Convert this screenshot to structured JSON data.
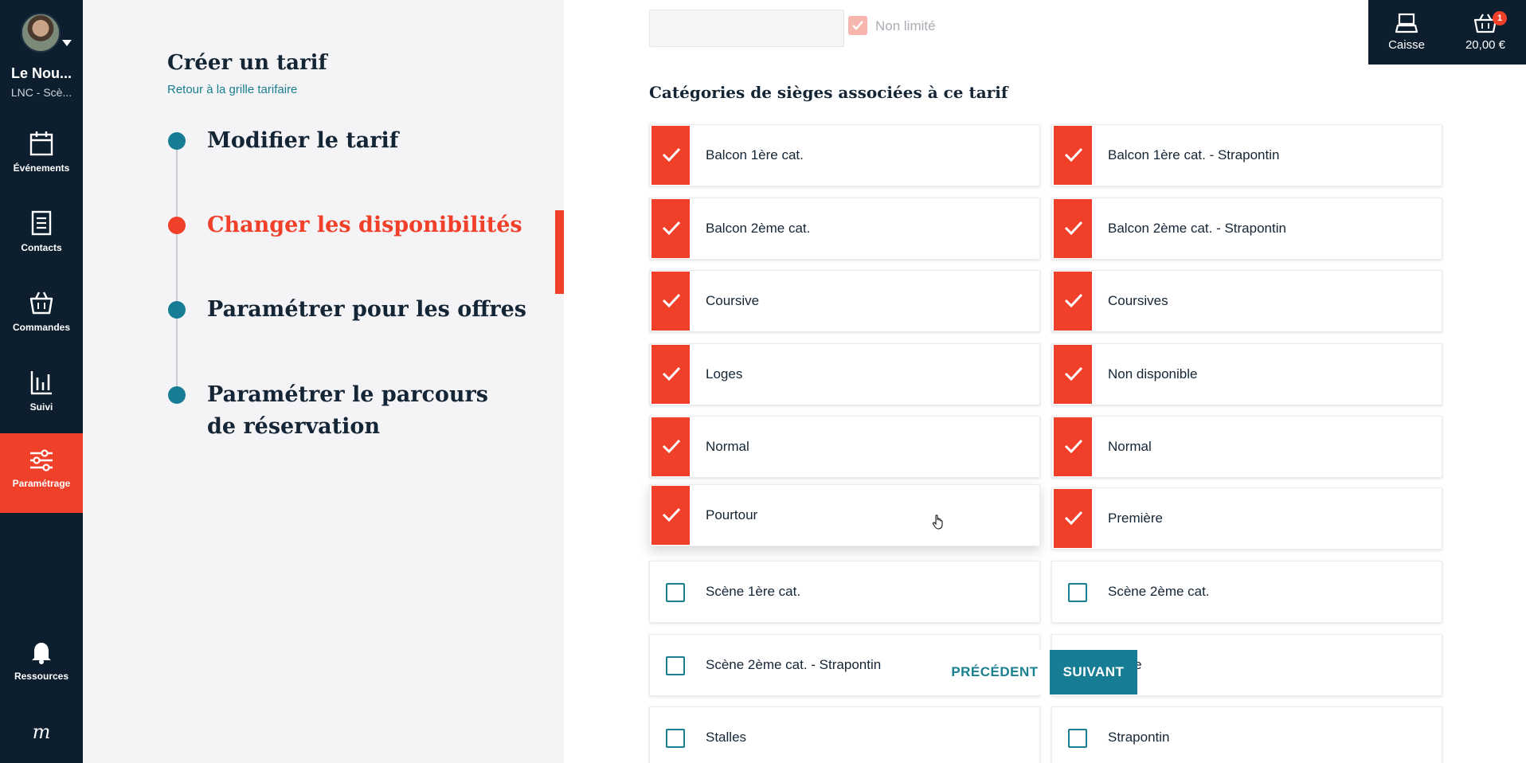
{
  "sidebar": {
    "org_name": "Le Nou...",
    "org_sub": "LNC - Scè...",
    "items": [
      {
        "label": "Événements",
        "icon": "calendar-icon"
      },
      {
        "label": "Contacts",
        "icon": "document-icon"
      },
      {
        "label": "Commandes",
        "icon": "basket-icon"
      },
      {
        "label": "Suivi",
        "icon": "bar-chart-icon"
      },
      {
        "label": "Paramétrage",
        "icon": "sliders-icon"
      },
      {
        "label": "Ressources",
        "icon": "bell-icon"
      }
    ],
    "logo": "m"
  },
  "left_panel": {
    "title": "Créer un tarif",
    "back_link": "Retour à la grille tarifaire",
    "steps": [
      {
        "label": "Modifier le tarif"
      },
      {
        "label": "Changer les disponibilités"
      },
      {
        "label": "Paramétrer pour les offres"
      },
      {
        "label": "Paramétrer le parcours de réservation"
      }
    ]
  },
  "content": {
    "non_limite_label": "Non limité",
    "section_title": "Catégories de sièges associées à ce tarif",
    "categories": [
      {
        "label": "Balcon 1ère cat.",
        "checked": true
      },
      {
        "label": "Balcon 1ère cat. - Strapontin",
        "checked": true
      },
      {
        "label": "Balcon 2ème cat.",
        "checked": true
      },
      {
        "label": "Balcon 2ème cat. - Strapontin",
        "checked": true
      },
      {
        "label": "Coursive",
        "checked": true
      },
      {
        "label": "Coursives",
        "checked": true
      },
      {
        "label": "Loges",
        "checked": true
      },
      {
        "label": "Non disponible",
        "checked": true
      },
      {
        "label": "Normal",
        "checked": true
      },
      {
        "label": "Normal",
        "checked": true
      },
      {
        "label": "Pourtour",
        "checked": true
      },
      {
        "label": "Première",
        "checked": true
      },
      {
        "label": "Scène 1ère cat.",
        "checked": false
      },
      {
        "label": "Scène 2ème cat.",
        "checked": false
      },
      {
        "label": "Scène 2ème cat. - Strapontin",
        "checked": false
      },
      {
        "label": "...nde",
        "checked": false
      },
      {
        "label": "Stalles",
        "checked": false
      },
      {
        "label": "Strapontin",
        "checked": false
      }
    ]
  },
  "topbar": {
    "caisse_label": "Caisse",
    "cart_total": "20,00 €",
    "cart_count": "1"
  },
  "nav": {
    "prev": "PRÉCÉDENT",
    "next": "SUIVANT"
  },
  "colors": {
    "accent": "#f0402a",
    "teal": "#177d94",
    "navy": "#0d1f2f"
  }
}
